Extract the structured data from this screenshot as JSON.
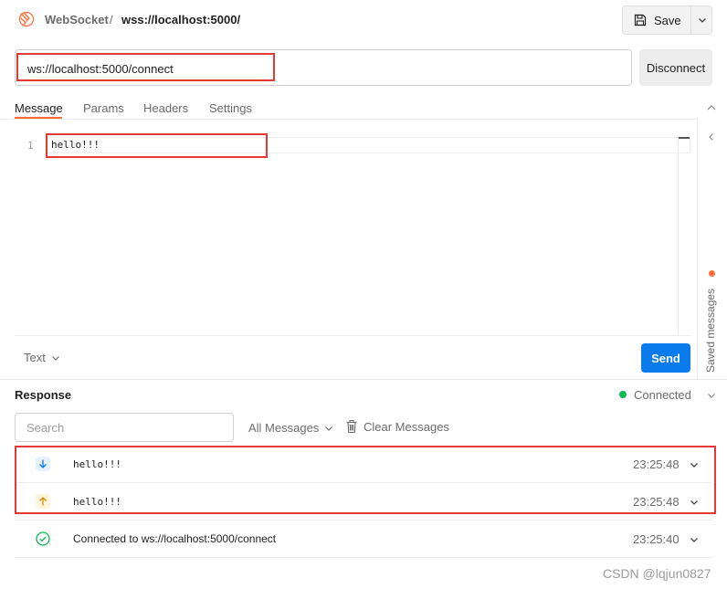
{
  "header": {
    "protocol_label": "WebSocket",
    "separator": "/",
    "request_name": "wss://localhost:5000/",
    "save_label": "Save"
  },
  "url_bar": {
    "value": "ws://localhost:5000/connect",
    "disconnect_label": "Disconnect"
  },
  "tabs": [
    {
      "label": "Message",
      "active": true
    },
    {
      "label": "Params",
      "active": false
    },
    {
      "label": "Headers",
      "active": false
    },
    {
      "label": "Settings",
      "active": false
    }
  ],
  "editor": {
    "line_number": "1",
    "content": "hello!!!"
  },
  "composer": {
    "body_type": "Text",
    "send_label": "Send"
  },
  "side_panel": {
    "label": "Saved messages"
  },
  "response": {
    "title": "Response",
    "status": "Connected",
    "search_placeholder": "Search",
    "filter_label": "All Messages",
    "clear_label": "Clear Messages",
    "messages": [
      {
        "direction": "incoming",
        "text": "hello!!!",
        "time": "23:25:48"
      },
      {
        "direction": "outgoing",
        "text": "hello!!!",
        "time": "23:25:48"
      },
      {
        "direction": "connected",
        "text": "Connected to ws://localhost:5000/connect",
        "time": "23:25:40"
      }
    ]
  },
  "watermark": "CSDN @lqjun0827",
  "colors": {
    "accent": "#ff6c37",
    "send": "#097bed",
    "connected": "#0cbb52",
    "highlight_box": "#e53935",
    "incoming_icon": "#097bed",
    "outgoing_icon": "#d98b00"
  }
}
